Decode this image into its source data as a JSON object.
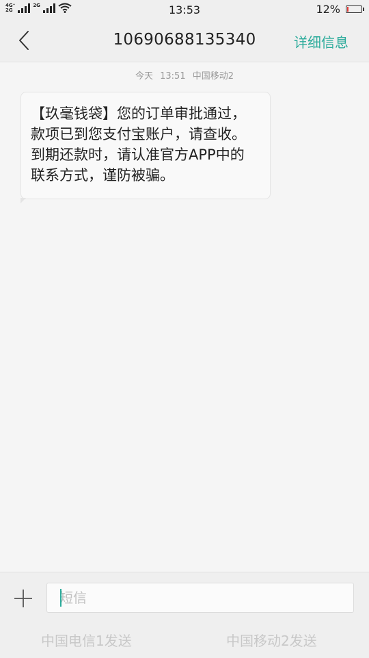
{
  "status_bar": {
    "network_top": "4G⁺",
    "network_bottom": "2G",
    "network_sim2": "2G",
    "time": "13:53",
    "battery_percent": "12%",
    "battery_level": 0.12,
    "battery_color": "#e53935"
  },
  "header": {
    "title": "10690688135340",
    "detail_label": "详细信息",
    "accent_color": "#2bab9b"
  },
  "conversation": {
    "meta": {
      "day": "今天",
      "time": "13:51",
      "carrier": "中国移动2"
    },
    "messages": [
      {
        "text": "【玖毫钱袋】您的订单审批通过，款项已到您支付宝账户，请查收。到期还款时，请认准官方APP中的联系方式，谨防被骗。"
      }
    ]
  },
  "composer": {
    "placeholder": "短信",
    "value": "",
    "send_sim1_label": "中国电信1发送",
    "send_sim2_label": "中国移动2发送"
  }
}
